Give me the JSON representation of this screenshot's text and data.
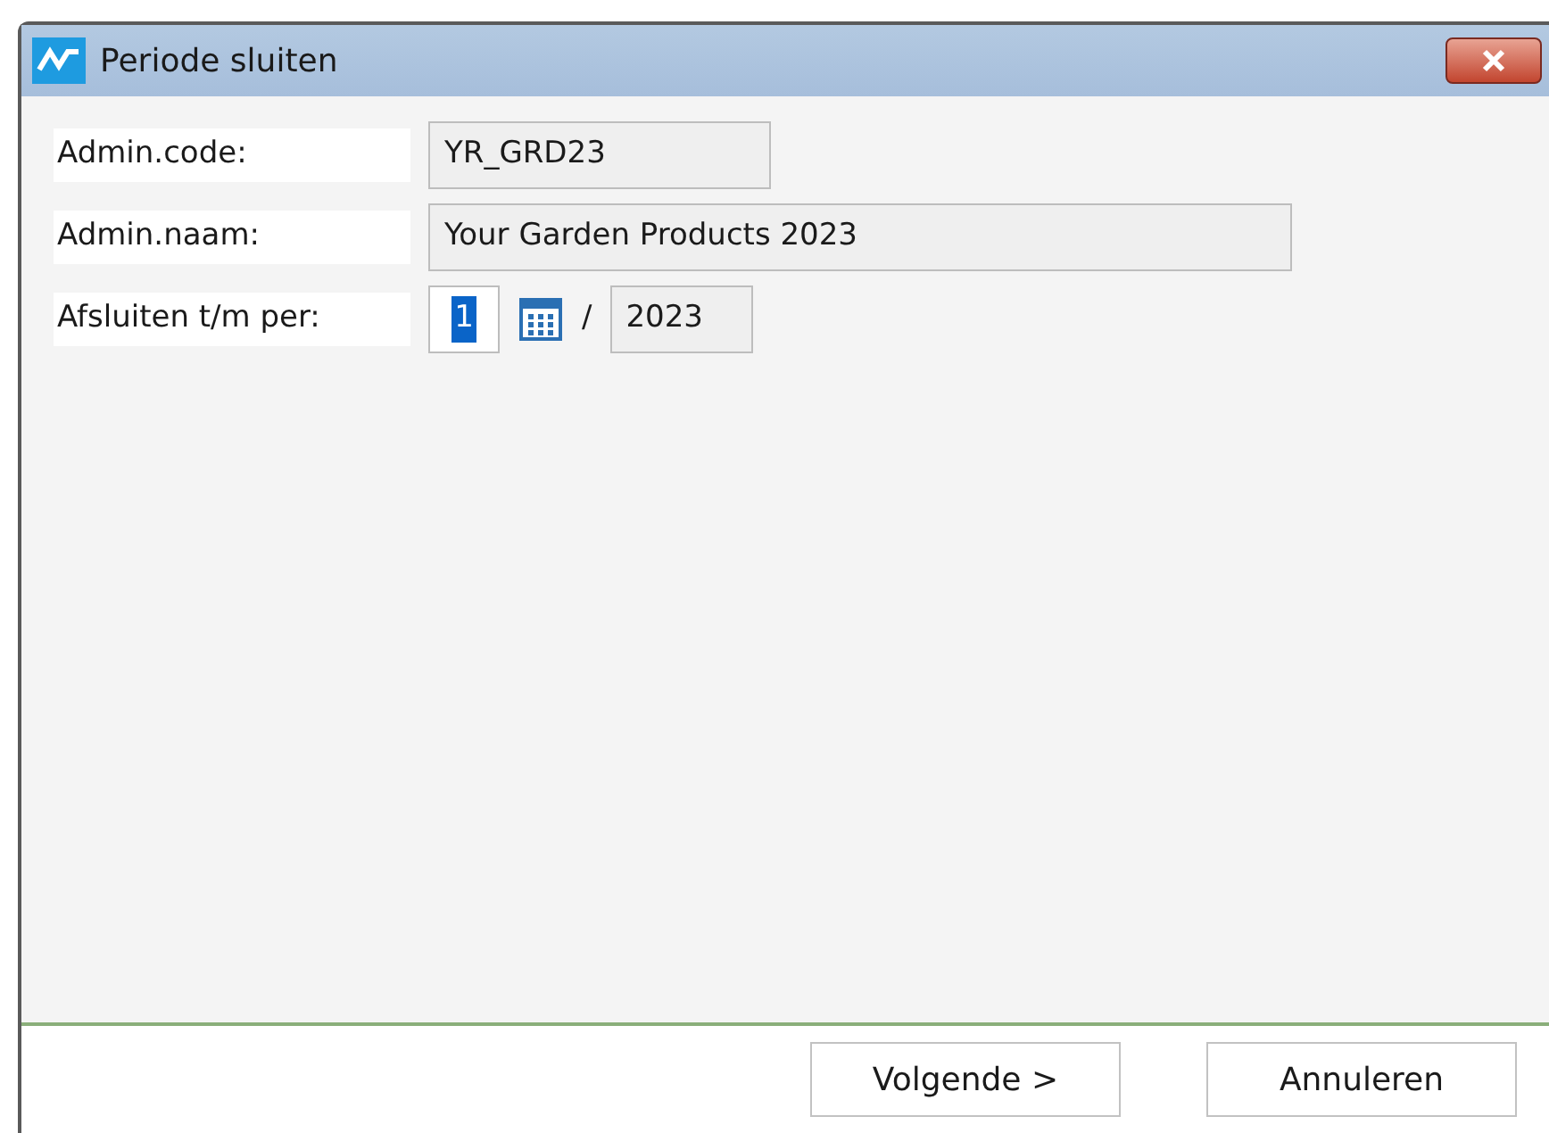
{
  "window": {
    "title": "Periode sluiten"
  },
  "fields": [
    {
      "label": "Admin.code:",
      "value": "YR_GRD23",
      "kind": "text"
    },
    {
      "label": "Admin.naam:",
      "value": "Your Garden Products 2023",
      "kind": "wide"
    },
    {
      "label": "Afsluiten t/m per:",
      "value": "1",
      "selected": true,
      "separator": "/",
      "year": "2023",
      "kind": "period"
    }
  ],
  "buttons": [
    "Volgende >",
    "Annuleren"
  ]
}
